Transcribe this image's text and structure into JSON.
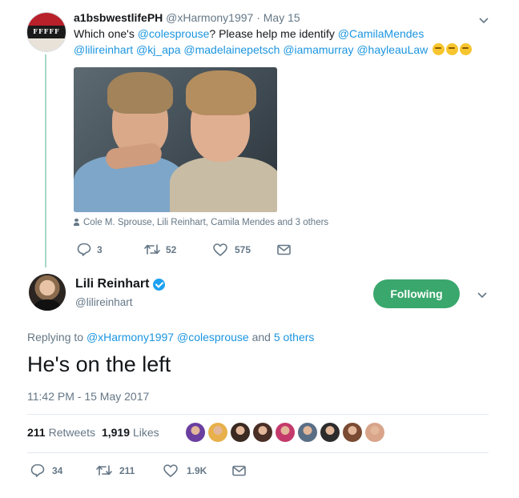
{
  "parent_tweet": {
    "avatar_text": "FFFFF",
    "display_name": "a1bsbwestlifePH",
    "handle": "@xHarmony1997",
    "separator": " · ",
    "date": "May 15",
    "text_part1": "Which one's ",
    "mention_coles": "@colesprouse",
    "text_part2": "? Please help me identify ",
    "mention_camila": "@CamilaMendes",
    "mention_lili": "@lilireinhart",
    "mention_kj": "@kj_apa",
    "mention_madelaine": "@madelainepetsch",
    "mention_iamamurray": "@iamamurray",
    "mention_hayleau": "@hayleauLaw",
    "emojis": [
      "thinking-face",
      "thinking-face",
      "thinking-face"
    ],
    "tagged_people": "Cole M. Sprouse, Lili Reinhart, Camila Mendes and 3 others",
    "reply_count": "3",
    "retweet_count": "52",
    "like_count": "575"
  },
  "main_tweet": {
    "display_name": "Lili Reinhart",
    "handle": "@lilireinhart",
    "follow_label": "Following",
    "replying_prefix": "Replying to ",
    "replying_user1": "@xHarmony1997",
    "replying_user2": "@colesprouse",
    "replying_suffix_and": " and ",
    "replying_others": "5 others",
    "text": "He's on the left",
    "timestamp": "11:42 PM - 15 May 2017",
    "retweets_count": "211",
    "retweets_label": "Retweets",
    "likes_count": "1,919",
    "likes_label": "Likes",
    "liker_colors": [
      "#6a3fa0",
      "#e8b04a",
      "#3b2a22",
      "#4a2f26",
      "#c43a6b",
      "#5a6f86",
      "#2c2c2c",
      "#7a4a32",
      "#d8a48a"
    ],
    "reply_count": "34",
    "retweet_count": "211",
    "like_count": "1.9K"
  },
  "colors": {
    "link": "#1b95e0",
    "follow_button": "#3aa76d",
    "thread_line": "#a5d8c7",
    "verified": "#1da1f2"
  }
}
